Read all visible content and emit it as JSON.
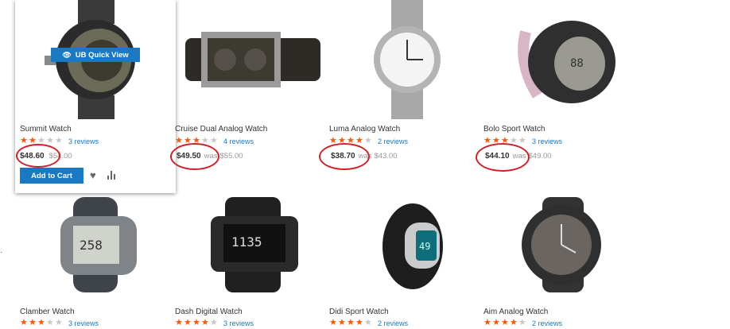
{
  "quick_view_label": "UB Quick View",
  "add_to_cart_label": "Add to Cart",
  "was_label": "was",
  "left_marker": "·",
  "products": [
    {
      "name": "Summit Watch",
      "stars": 2,
      "reviews": "3 reviews",
      "price": "$48.60",
      "old_price": "$54.00",
      "highlight": true
    },
    {
      "name": "Cruise Dual Analog Watch",
      "stars": 3,
      "reviews": "4 reviews",
      "price": "$49.50",
      "old_price": "$55.00",
      "highlight": false
    },
    {
      "name": "Luma Analog Watch",
      "stars": 4,
      "reviews": "2 reviews",
      "price": "$38.70",
      "old_price": "$43.00",
      "highlight": false
    },
    {
      "name": "Bolo Sport Watch",
      "stars": 3,
      "reviews": "3 reviews",
      "price": "$44.10",
      "old_price": "$49.00",
      "highlight": false
    },
    {
      "name": "Clamber Watch",
      "stars": 2.5,
      "reviews": "3 reviews"
    },
    {
      "name": "Dash Digital Watch",
      "stars": 3.5,
      "reviews": "3 reviews"
    },
    {
      "name": "Didi Sport Watch",
      "stars": 3.5,
      "reviews": "2 reviews"
    },
    {
      "name": "Aim Analog Watch",
      "stars": 4,
      "reviews": "2 reviews"
    }
  ],
  "colors": {
    "accent": "#1979c3",
    "star": "#ff5501",
    "circle": "#d02028"
  }
}
